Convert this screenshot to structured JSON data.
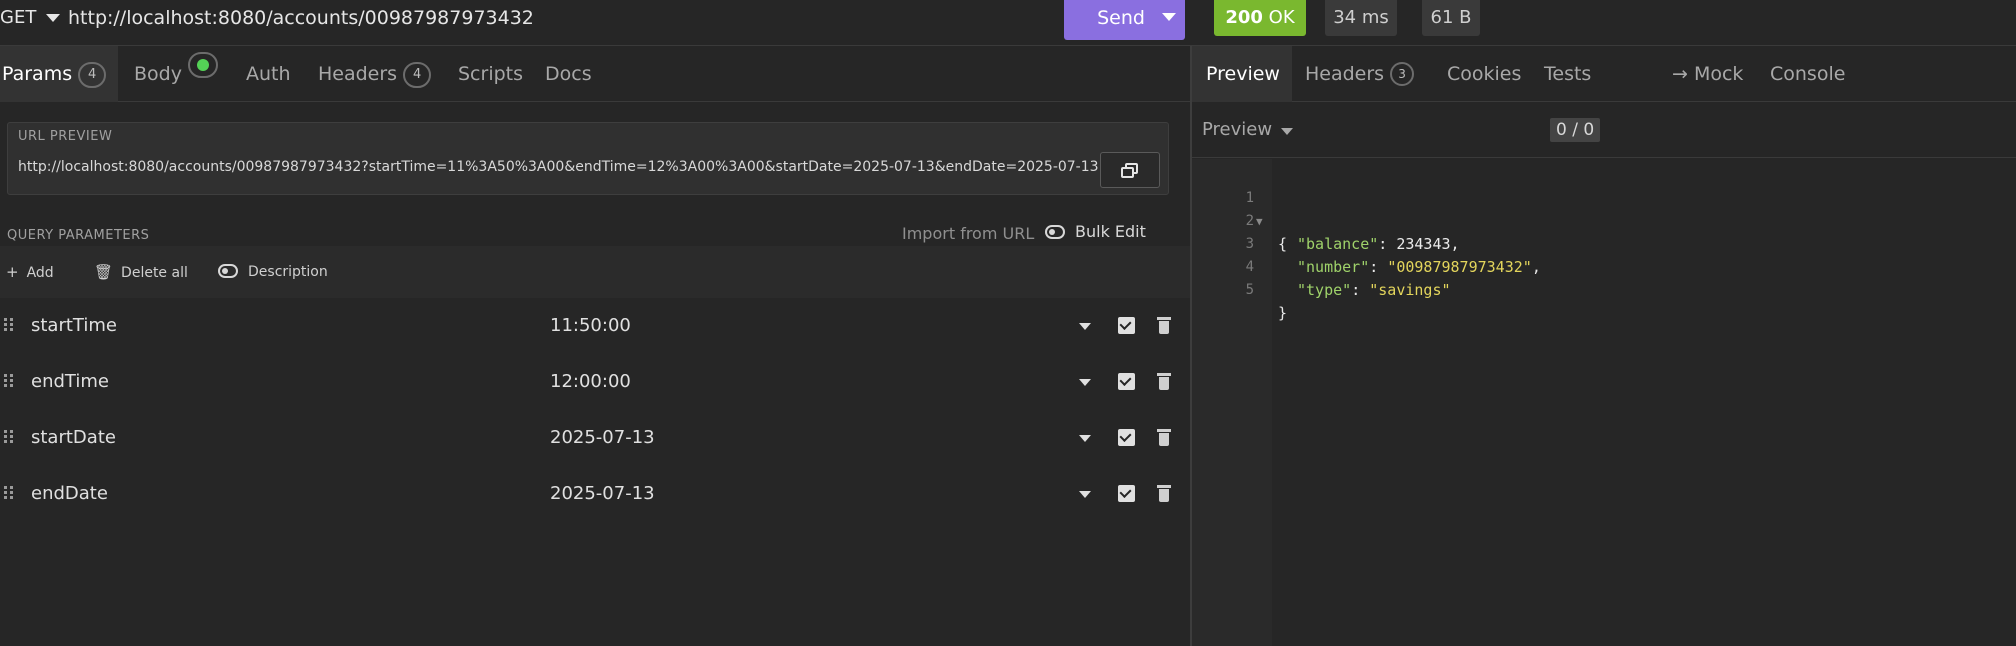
{
  "request": {
    "method": "GET",
    "url": "http://localhost:8080/accounts/00987987973432",
    "send_label": "Send"
  },
  "response_meta": {
    "status_code": "200",
    "status_text": "OK",
    "time": "34 ms",
    "size": "61 B"
  },
  "request_tabs": [
    {
      "label": "Params",
      "badge": "4"
    },
    {
      "label": "Body"
    },
    {
      "label": "Auth"
    },
    {
      "label": "Headers",
      "badge": "4"
    },
    {
      "label": "Scripts"
    },
    {
      "label": "Docs"
    }
  ],
  "url_preview": {
    "title": "URL PREVIEW",
    "value": "http://localhost:8080/accounts/00987987973432?startTime=11%3A50%3A00&endTime=12%3A00%3A00&startDate=2025-07-13&endDate=2025-07-13"
  },
  "query_params": {
    "title": "QUERY PARAMETERS",
    "import_label": "Import from URL",
    "bulk_label": "Bulk Edit",
    "add_label": "Add",
    "delete_all_label": "Delete all",
    "description_label": "Description",
    "rows": [
      {
        "name": "startTime",
        "value": "11:50:00",
        "enabled": true
      },
      {
        "name": "endTime",
        "value": "12:00:00",
        "enabled": true
      },
      {
        "name": "startDate",
        "value": "2025-07-13",
        "enabled": true
      },
      {
        "name": "endDate",
        "value": "2025-07-13",
        "enabled": true
      }
    ]
  },
  "response_tabs": [
    {
      "label": "Preview"
    },
    {
      "label": "Headers",
      "badge": "3"
    },
    {
      "label": "Cookies"
    },
    {
      "label": "Tests",
      "count": "0 / 0"
    },
    {
      "label": "→ Mock"
    },
    {
      "label": "Console"
    }
  ],
  "preview_mode": "Preview",
  "response_body": {
    "lines": [
      {
        "no": "1",
        "open": "{"
      },
      {
        "no": "2",
        "key": "\"balance\"",
        "value": "234343",
        "type": "number",
        "trail": ","
      },
      {
        "no": "3",
        "key": "\"number\"",
        "value": "\"00987987973432\"",
        "type": "string",
        "trail": ","
      },
      {
        "no": "4",
        "key": "\"type\"",
        "value": "\"savings\"",
        "type": "string",
        "trail": ""
      },
      {
        "no": "5",
        "close": "}"
      }
    ]
  },
  "colors": {
    "accent": "#8a6fe0",
    "status_ok": "#7ab82f",
    "json_key": "#9fd26a",
    "json_string": "#e3d55c",
    "enabled_dot": "#54d256"
  }
}
